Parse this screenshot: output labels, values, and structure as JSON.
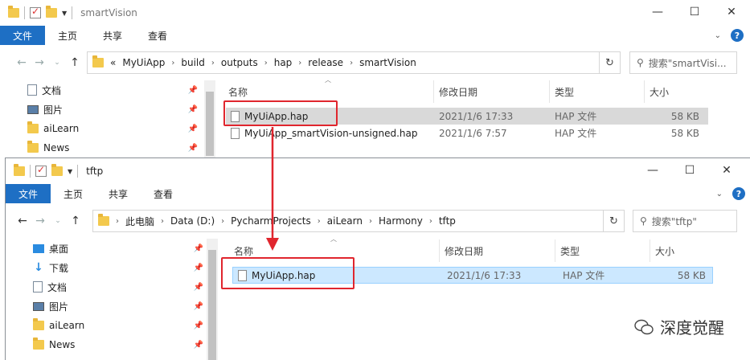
{
  "window1": {
    "title": "smartVision",
    "ribbon_tabs": [
      "文件",
      "主页",
      "共享",
      "查看"
    ],
    "breadcrumb": [
      "«",
      "MyUiApp",
      "build",
      "outputs",
      "hap",
      "release",
      "smartVision"
    ],
    "search_placeholder": "搜索\"smartVisi...",
    "nav_items": [
      {
        "label": "文档",
        "icon": "document-icon"
      },
      {
        "label": "图片",
        "icon": "picture-icon"
      },
      {
        "label": "aiLearn",
        "icon": "folder-icon"
      },
      {
        "label": "News",
        "icon": "folder-icon"
      }
    ],
    "columns": [
      "名称",
      "修改日期",
      "类型",
      "大小"
    ],
    "files": [
      {
        "name": "MyUiApp.hap",
        "date": "2021/1/6 17:33",
        "type": "HAP 文件",
        "size": "58 KB"
      },
      {
        "name": "MyUiApp_smartVision-unsigned.hap",
        "date": "2021/1/6 7:57",
        "type": "HAP 文件",
        "size": "58 KB"
      }
    ]
  },
  "window2": {
    "title": "tftp",
    "ribbon_tabs": [
      "文件",
      "主页",
      "共享",
      "查看"
    ],
    "breadcrumb": [
      "此电脑",
      "Data (D:)",
      "PycharmProjects",
      "aiLearn",
      "Harmony",
      "tftp"
    ],
    "search_placeholder": "搜索\"tftp\"",
    "nav_items": [
      {
        "label": "桌面",
        "icon": "desktop-icon"
      },
      {
        "label": "下载",
        "icon": "download-icon"
      },
      {
        "label": "文档",
        "icon": "document-icon"
      },
      {
        "label": "图片",
        "icon": "picture-icon"
      },
      {
        "label": "aiLearn",
        "icon": "folder-icon"
      },
      {
        "label": "News",
        "icon": "folder-icon"
      }
    ],
    "columns": [
      "名称",
      "修改日期",
      "类型",
      "大小"
    ],
    "files": [
      {
        "name": "MyUiApp.hap",
        "date": "2021/1/6 17:33",
        "type": "HAP 文件",
        "size": "58 KB"
      }
    ]
  },
  "watermark": "深度觉醒",
  "colors": {
    "accent": "#1e6fc4",
    "highlight": "#e0262e",
    "selection": "#cce8ff"
  }
}
